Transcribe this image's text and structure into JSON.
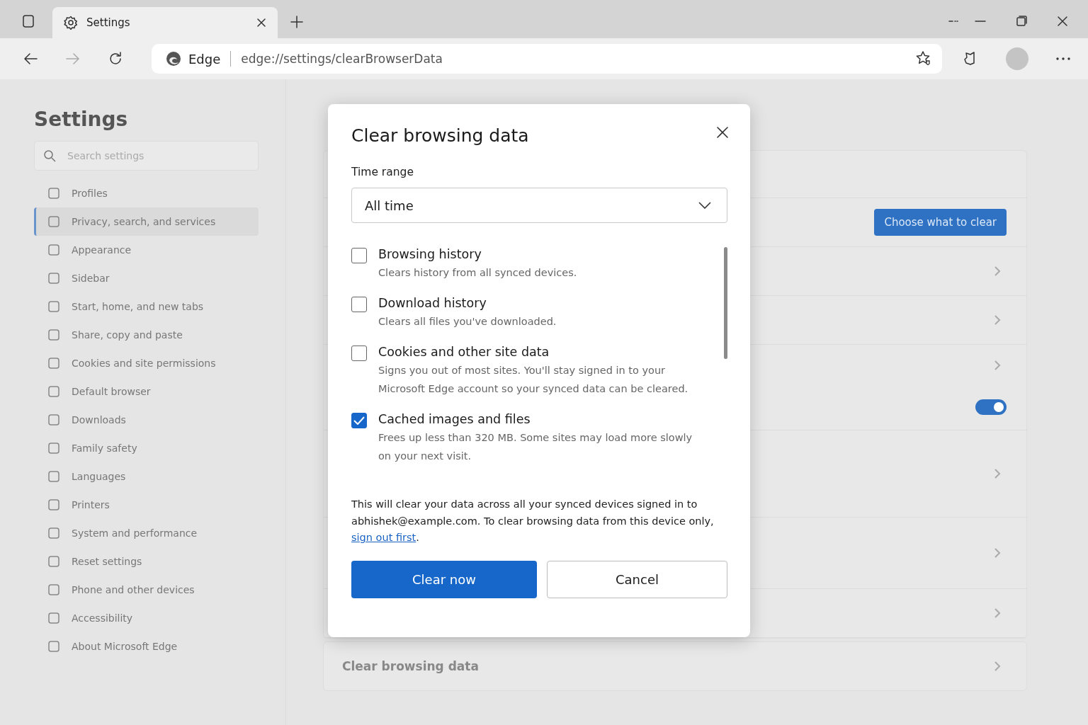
{
  "browser": {
    "tab": {
      "title": "Settings",
      "selected": true
    },
    "address": {
      "site": "Edge",
      "url": "edge://settings/clearBrowserData"
    }
  },
  "sidebar": {
    "title": "Settings",
    "search": {
      "placeholder": "Search settings"
    },
    "items": [
      {
        "label": "Profiles",
        "selected": false
      },
      {
        "label": "Privacy, search, and services",
        "selected": true
      },
      {
        "label": "Appearance",
        "selected": false
      },
      {
        "label": "Sidebar",
        "selected": false
      },
      {
        "label": "Start, home, and new tabs",
        "selected": false
      },
      {
        "label": "Share, copy and paste",
        "selected": false
      },
      {
        "label": "Cookies and site permissions",
        "selected": false
      },
      {
        "label": "Default browser",
        "selected": false
      },
      {
        "label": "Downloads",
        "selected": false
      },
      {
        "label": "Family safety",
        "selected": false
      },
      {
        "label": "Languages",
        "selected": false
      },
      {
        "label": "Printers",
        "selected": false
      },
      {
        "label": "System and performance",
        "selected": false
      },
      {
        "label": "Reset settings",
        "selected": false
      },
      {
        "label": "Phone and other devices",
        "selected": false
      },
      {
        "label": "Accessibility",
        "selected": false
      },
      {
        "label": "About Microsoft Edge",
        "selected": false
      }
    ]
  },
  "main": {
    "rows": [
      {
        "kind": "blank"
      },
      {
        "kind": "button",
        "label": "Choose what to clear"
      },
      {
        "kind": "link"
      },
      {
        "kind": "link"
      },
      {
        "kind": "toggle",
        "on": true
      },
      {
        "kind": "link"
      },
      {
        "kind": "link"
      },
      {
        "kind": "link"
      }
    ],
    "bottom_row": {
      "title": "Clear browsing data"
    }
  },
  "dialog": {
    "title": "Clear browsing data",
    "time_range": {
      "label": "Time range",
      "value": "All time"
    },
    "options": [
      {
        "label": "Browsing history",
        "description": "Clears history from all synced devices.",
        "checked": false
      },
      {
        "label": "Download history",
        "description": "Clears all files you've downloaded.",
        "checked": false
      },
      {
        "label": "Cookies and other site data",
        "description": "Signs you out of most sites. You'll stay signed in to your Microsoft Edge account so your synced data can be cleared.",
        "checked": false
      },
      {
        "label": "Cached images and files",
        "description": "Frees up less than 320 MB. Some sites may load more slowly on your next visit.",
        "checked": true
      }
    ],
    "note": "This will clear your data across all your synced devices signed in to abhishek@example.com. To clear browsing data from this device only,",
    "note_link": "sign out first",
    "note_end": ".",
    "buttons": [
      {
        "label": "Clear now",
        "kind": "primary"
      },
      {
        "label": "Cancel",
        "kind": "secondary"
      }
    ]
  }
}
